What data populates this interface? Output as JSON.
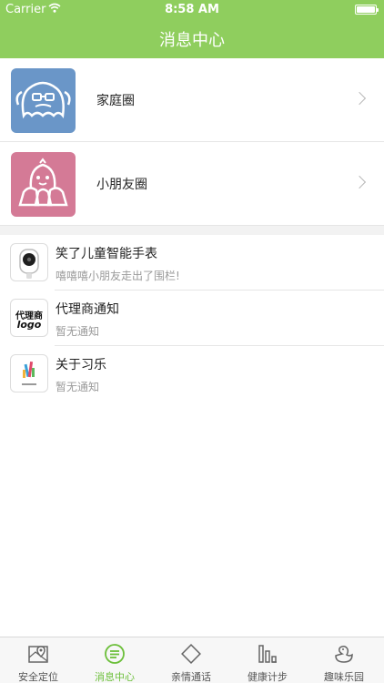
{
  "status_bar": {
    "carrier": "Carrier",
    "time": "8:58 AM"
  },
  "header": {
    "title": "消息中心"
  },
  "circles": [
    {
      "label": "家庭圈",
      "icon": "family-ghost-icon",
      "color": "#6a96c8"
    },
    {
      "label": "小朋友圈",
      "icon": "kids-ghost-icon",
      "color": "#d47a96"
    }
  ],
  "messages": [
    {
      "title": "笑了儿童智能手表",
      "subtitle": "嘻嘻嘻小朋友走出了围栏!",
      "icon": "smartwatch-icon"
    },
    {
      "title": "代理商通知",
      "subtitle": "暂无通知",
      "icon": "agent-logo-icon",
      "logo_text_top": "代理商",
      "logo_text_bottom": "logo"
    },
    {
      "title": "关于习乐",
      "subtitle": "暂无通知",
      "icon": "xile-logo-icon"
    }
  ],
  "tabs": [
    {
      "label": "安全定位",
      "icon": "map-pin-icon",
      "active": false
    },
    {
      "label": "消息中心",
      "icon": "message-icon",
      "active": true
    },
    {
      "label": "亲情通话",
      "icon": "phone-diamond-icon",
      "active": false
    },
    {
      "label": "健康计步",
      "icon": "bar-chart-icon",
      "active": false
    },
    {
      "label": "趣味乐园",
      "icon": "duck-icon",
      "active": false
    }
  ],
  "colors": {
    "header": "#8fce5e",
    "active_tab": "#6cbf3a"
  }
}
